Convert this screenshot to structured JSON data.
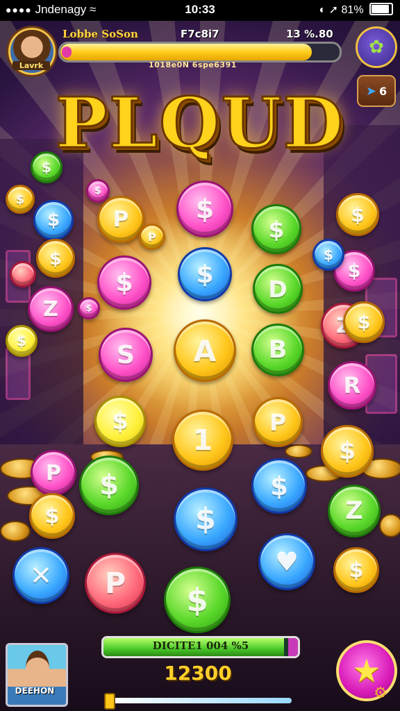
{
  "status_bar": {
    "dots": "●●●●",
    "carrier": "Jndenagy",
    "time": "10:33",
    "battery": "81%"
  },
  "hud": {
    "player_name": "Lobbe SoSon",
    "level_text": "F7c8i7",
    "count_text": "13 %.80",
    "xp_caption": "1018e0N 6spe6391",
    "xp_fraction": 0.9,
    "avatar_label": "Lavrk",
    "notifications_count": "6"
  },
  "title": "PLQUD",
  "coins": [
    {
      "color": "green",
      "glyph": "$"
    },
    {
      "color": "gold",
      "glyph": "$"
    },
    {
      "color": "pink",
      "glyph": "$"
    },
    {
      "color": "gold",
      "glyph": "P"
    },
    {
      "color": "pink",
      "glyph": "$"
    },
    {
      "color": "green",
      "glyph": "$"
    },
    {
      "color": "gold",
      "glyph": "P"
    },
    {
      "color": "red",
      "glyph": ""
    },
    {
      "color": "blue",
      "glyph": "$"
    },
    {
      "color": "pink",
      "glyph": "$"
    },
    {
      "color": "blue",
      "glyph": "$"
    },
    {
      "color": "green",
      "glyph": "D"
    },
    {
      "color": "gold",
      "glyph": "$"
    },
    {
      "color": "pink",
      "glyph": "$"
    },
    {
      "color": "pink",
      "glyph": "Z"
    },
    {
      "color": "gold",
      "glyph": "A"
    },
    {
      "color": "green",
      "glyph": "B"
    },
    {
      "color": "red",
      "glyph": "Z"
    },
    {
      "color": "pink",
      "glyph": "S"
    },
    {
      "color": "pink",
      "glyph": "R"
    },
    {
      "color": "yellow",
      "glyph": "$"
    },
    {
      "color": "yellow",
      "glyph": "$"
    },
    {
      "color": "gold",
      "glyph": "P"
    },
    {
      "color": "gold",
      "glyph": "1"
    },
    {
      "color": "gold",
      "glyph": "$"
    },
    {
      "color": "blue",
      "glyph": "$"
    },
    {
      "color": "green",
      "glyph": "$"
    },
    {
      "color": "blue",
      "glyph": "$"
    },
    {
      "color": "pink",
      "glyph": "P"
    },
    {
      "color": "gold",
      "glyph": "$"
    },
    {
      "color": "blue",
      "glyph": "✕"
    },
    {
      "color": "green",
      "glyph": "Z"
    },
    {
      "color": "blue",
      "glyph": "♥"
    },
    {
      "color": "gold",
      "glyph": "$"
    },
    {
      "color": "green",
      "glyph": "$"
    },
    {
      "color": "red",
      "glyph": "P"
    },
    {
      "color": "gold",
      "glyph": "$"
    },
    {
      "color": "pink",
      "glyph": "$"
    },
    {
      "color": "gold",
      "glyph": "$"
    },
    {
      "color": "blue",
      "glyph": "$"
    }
  ],
  "footer": {
    "avatar_label": "DEEHON",
    "progress_label": "DICITE1 004 %5",
    "progress_fraction": 0.93,
    "score": "12300",
    "star_icon": "star-icon",
    "gear_icon": "gear-icon"
  },
  "colors": {
    "gold": "#ffc61a",
    "pink": "#ff52c8",
    "green": "#5ad82a",
    "blue": "#3aa8ff"
  }
}
